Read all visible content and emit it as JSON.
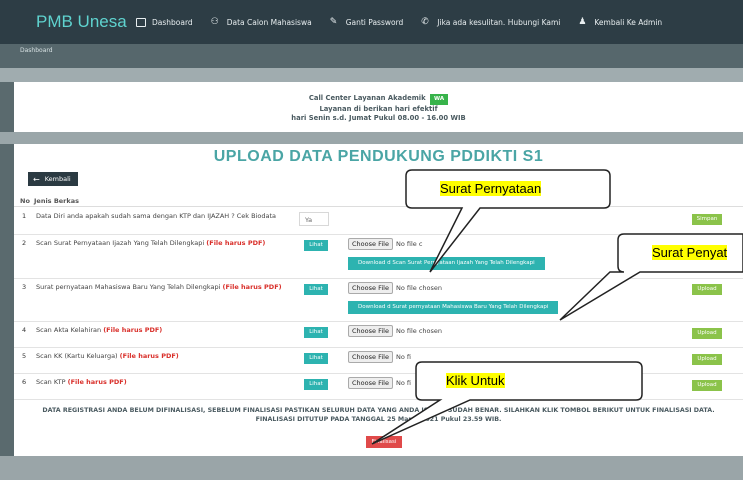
{
  "nav": {
    "brand": "PMB Unesa",
    "items": [
      {
        "label": "Dashboard",
        "icon": "monitor-icon"
      },
      {
        "label": "Data Calon Mahasiswa",
        "icon": "users-icon"
      },
      {
        "label": "Ganti Password",
        "icon": "pencil-icon"
      },
      {
        "label": "Jika ada kesulitan. Hubungi Kami",
        "icon": "phone-icon"
      },
      {
        "label": "Kembali Ke Admin",
        "icon": "user-icon"
      }
    ]
  },
  "breadcrumb": "Dashboard",
  "info": {
    "line1": "Call Center Layanan Akademik",
    "wa": "WA",
    "line2": "Layanan di berikan hari efektif",
    "line3": "hari Senin s.d. Jumat Pukul 08.00 - 16.00 WIB"
  },
  "page_title": "UPLOAD DATA PENDUKUNG PDDIKTI S1",
  "back_label": "Kembali",
  "table": {
    "headers": {
      "no": "No",
      "jenis": "Jenis Berkas"
    },
    "pdf_note": "(File harus PDF)",
    "rows": [
      {
        "no": "1",
        "text": "Data Diri anda apakah sudah sama dengan KTP dan IJAZAH ? Cek Biodata",
        "value": "Ya",
        "action": "Simpan"
      },
      {
        "no": "2",
        "text": "Scan Surat Pernyataan Ijazah Yang Telah Dilengkapi",
        "lihat": "Lihat",
        "choose": "Choose File",
        "file": "No file c",
        "download": "Download d Scan Surat Pernyataan Ijazah Yang Telah Dilengkapi"
      },
      {
        "no": "3",
        "text": "Surat pernyataan Mahasiswa Baru Yang Telah Dilengkapi",
        "lihat": "Lihat",
        "choose": "Choose File",
        "file": "No file chosen",
        "download": "Download d Surat pernyataan Mahasiswa Baru Yang Telah Dilengkapi",
        "action": "Upload"
      },
      {
        "no": "4",
        "text": "Scan Akta Kelahiran",
        "lihat": "Lihat",
        "choose": "Choose File",
        "file": "No file chosen",
        "action": "Upload"
      },
      {
        "no": "5",
        "text": "Scan KK (Kartu Keluarga)",
        "lihat": "Lihat",
        "choose": "Choose File",
        "file": "No fi",
        "action": "Upload"
      },
      {
        "no": "6",
        "text": "Scan KTP",
        "lihat": "Lihat",
        "choose": "Choose File",
        "file": "No fi",
        "action": "Upload"
      }
    ]
  },
  "notice": {
    "line1": "DATA REGISTRASI ANDA BELUM DIFINALISASI, SEBELUM FINALISASI PASTIKAN SELURUH DATA YANG ANDA ISIKAN SUDAH BENAR. SILAHKAN KLIK TOMBOL BERIKUT UNTUK FINALISASI DATA.",
    "line2": "FINALISASI DITUTUP PADA TANGGAL 25 Maret 2021 Pukul 23.59 WIB."
  },
  "finalisasi_label": "Finalisasi",
  "callouts": {
    "c1": "Surat Pernyataan",
    "c2": "Surat Penyat",
    "c3": "Klik Untuk"
  }
}
